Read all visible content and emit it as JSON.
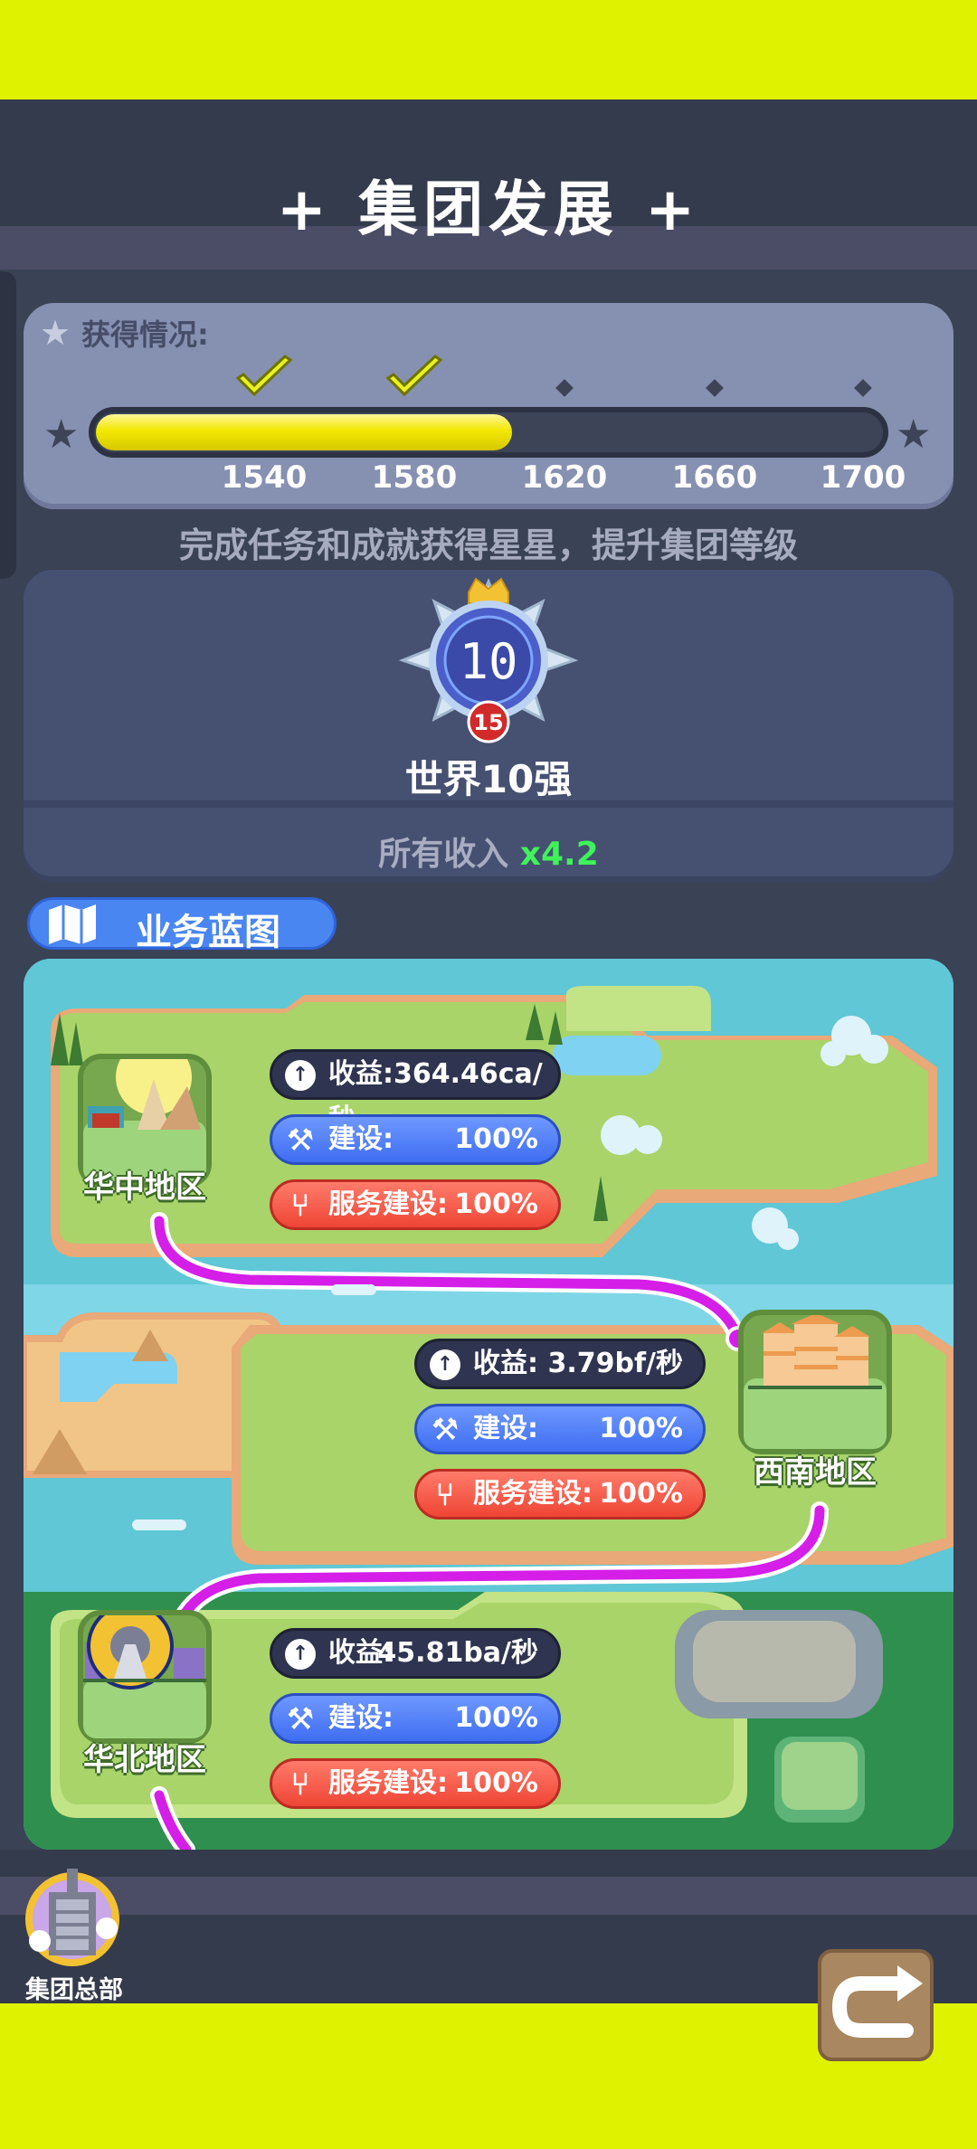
{
  "header": {
    "title": "+  集团发展  +"
  },
  "stars": {
    "label": "获得情况:",
    "progress": 0.53,
    "ticks": [
      "1540",
      "1580",
      "1620",
      "1660",
      "1700"
    ],
    "reached": [
      true,
      true,
      false,
      false,
      false
    ]
  },
  "hint": "完成任务和成就获得星星，提升集团等级",
  "rank": {
    "badge_number": "10",
    "badge_level": "15",
    "name": "世界10强",
    "income_label": "所有收入",
    "income_multiplier": "x4.2"
  },
  "blueprint": {
    "title": "业务蓝图"
  },
  "regions": [
    {
      "name": "华中地区",
      "income_label": "收益:364.46ca/秒",
      "income_value": "",
      "build_label": "建设:",
      "build_value": "100%",
      "service_label": "服务建设:",
      "service_value": "100%"
    },
    {
      "name": "西南地区",
      "income_label": "收益:",
      "income_value": "3.79bf/秒",
      "build_label": "建设:",
      "build_value": "100%",
      "service_label": "服务建设:",
      "service_value": "100%"
    },
    {
      "name": "华北地区",
      "income_label": "收益:",
      "income_value": "45.81ba/秒",
      "build_label": "建设:",
      "build_value": "100%",
      "service_label": "服务建设:",
      "service_value": "100%"
    }
  ],
  "footer": {
    "hq_label": "集团总部"
  },
  "icons": {
    "income": "income-icon",
    "build": "hammer-icon",
    "service": "fork-knife-icon",
    "return": "return-arrow-icon"
  },
  "colors": {
    "accent_yellow": "#dff200",
    "income_green": "#3ff25a",
    "route_magenta": "#d51ee8"
  }
}
